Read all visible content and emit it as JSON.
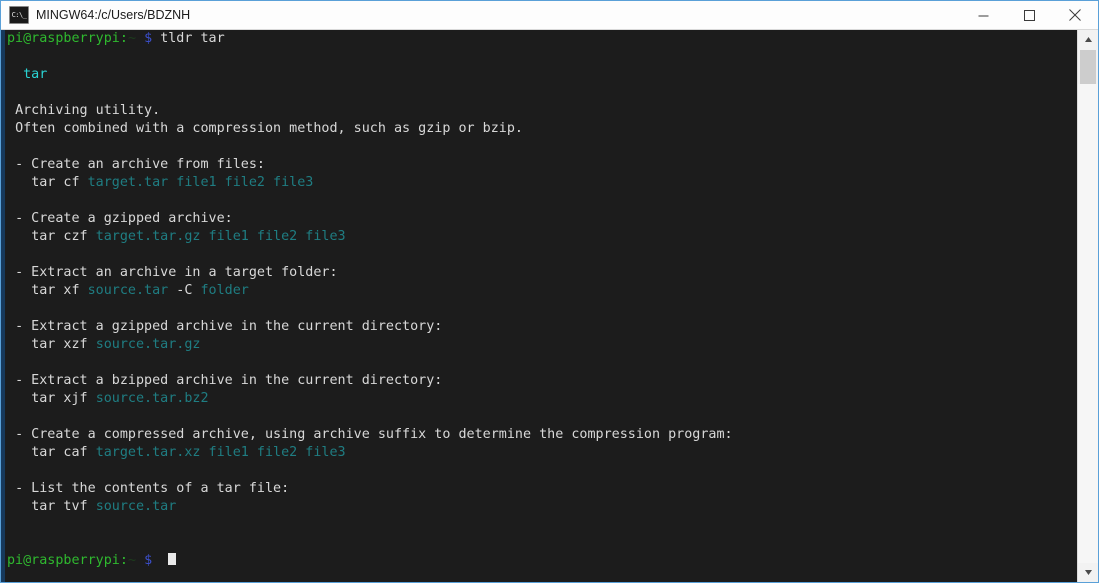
{
  "window": {
    "title": "MINGW64:/c/Users/BDZNH",
    "icon": "console-icon",
    "icon_glyph": "C:\\_",
    "minimize_label": "Minimize",
    "maximize_label": "Maximize",
    "close_label": "Close",
    "border_color": "#5aa0d8",
    "titlebar_bg": "#fdfdfd"
  },
  "terminal": {
    "background": "#1c1c1c",
    "foreground": "#d4d4d4",
    "colors": {
      "prompt_user_host": "#2fb92f",
      "prompt_path": "#1d3d1d",
      "prompt_dollar": "#3b4ec9",
      "command_heading": "#2ad4d4",
      "command_argument": "#1f7d82",
      "plain_text": "#d8d8d8"
    },
    "prompt": {
      "user_host": "pi@raspberrypi:",
      "path": "~",
      "dollar": "$"
    },
    "typed_command": "tldr tar",
    "cursor": "block",
    "lines": [
      {
        "type": "prompt",
        "command": "tldr tar"
      },
      {
        "type": "blank"
      },
      {
        "type": "heading",
        "indent": "  ",
        "text": "tar"
      },
      {
        "type": "blank"
      },
      {
        "type": "plain",
        "indent": " ",
        "text": "Archiving utility."
      },
      {
        "type": "plain",
        "indent": " ",
        "text": "Often combined with a compression method, such as gzip or bzip."
      },
      {
        "type": "blank"
      },
      {
        "type": "bullet",
        "indent": " ",
        "text": "- Create an archive from files:"
      },
      {
        "type": "code",
        "indent": "   ",
        "command": "tar cf ",
        "argument": "target.tar file1 file2 file3"
      },
      {
        "type": "blank"
      },
      {
        "type": "bullet",
        "indent": " ",
        "text": "- Create a gzipped archive:"
      },
      {
        "type": "code",
        "indent": "   ",
        "command": "tar czf ",
        "argument": "target.tar.gz file1 file2 file3"
      },
      {
        "type": "blank"
      },
      {
        "type": "bullet",
        "indent": " ",
        "text": "- Extract an archive in a target folder:"
      },
      {
        "type": "code2",
        "indent": "   ",
        "command": "tar xf ",
        "argument": "source.tar",
        "flag": " -C ",
        "argument2": "folder"
      },
      {
        "type": "blank"
      },
      {
        "type": "bullet",
        "indent": " ",
        "text": "- Extract a gzipped archive in the current directory:"
      },
      {
        "type": "code",
        "indent": "   ",
        "command": "tar xzf ",
        "argument": "source.tar.gz"
      },
      {
        "type": "blank"
      },
      {
        "type": "bullet",
        "indent": " ",
        "text": "- Extract a bzipped archive in the current directory:"
      },
      {
        "type": "code",
        "indent": "   ",
        "command": "tar xjf ",
        "argument": "source.tar.bz2"
      },
      {
        "type": "blank"
      },
      {
        "type": "bullet",
        "indent": " ",
        "text": "- Create a compressed archive, using archive suffix to determine the compression program:"
      },
      {
        "type": "code",
        "indent": "   ",
        "command": "tar caf ",
        "argument": "target.tar.xz file1 file2 file3"
      },
      {
        "type": "blank"
      },
      {
        "type": "bullet",
        "indent": " ",
        "text": "- List the contents of a tar file:"
      },
      {
        "type": "code",
        "indent": "   ",
        "command": "tar tvf ",
        "argument": "source.tar"
      },
      {
        "type": "blank"
      },
      {
        "type": "blank"
      },
      {
        "type": "prompt_cursor"
      }
    ]
  },
  "scrollbar": {
    "up_arrow": "scroll-up-arrow",
    "down_arrow": "scroll-down-arrow",
    "thumb": "scroll-thumb"
  }
}
